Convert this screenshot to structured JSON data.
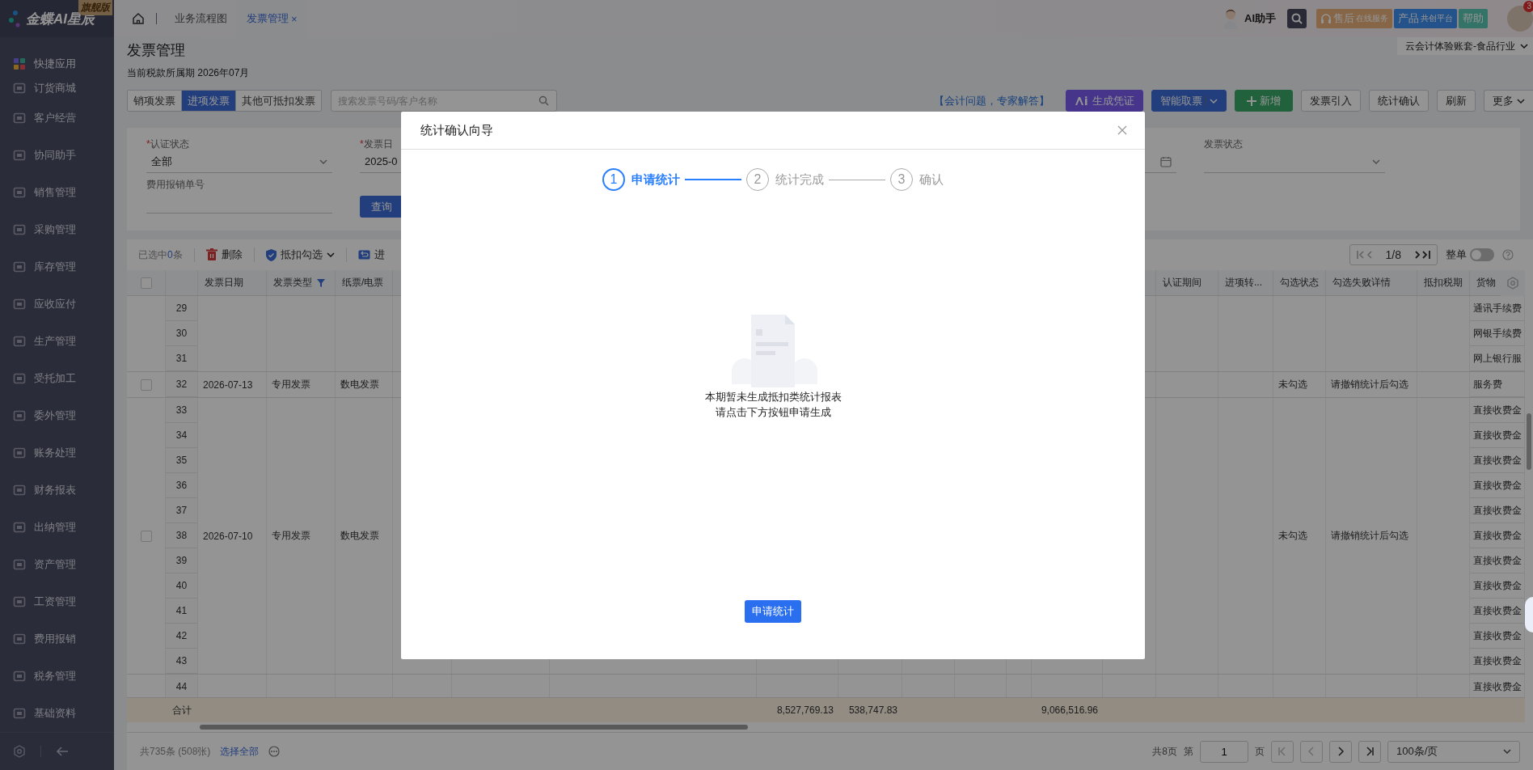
{
  "sidebar": {
    "logo": {
      "text": "金蝶AI星辰",
      "badge": "旗舰版"
    },
    "pinned": {
      "label": "快捷应用"
    },
    "items": [
      {
        "label": "订货商城"
      },
      {
        "label": "客户经营"
      },
      {
        "label": "协同助手"
      },
      {
        "label": "销售管理"
      },
      {
        "label": "采购管理"
      },
      {
        "label": "库存管理"
      },
      {
        "label": "应收应付"
      },
      {
        "label": "生产管理"
      },
      {
        "label": "受托加工"
      },
      {
        "label": "委外管理"
      },
      {
        "label": "账务处理"
      },
      {
        "label": "财务报表"
      },
      {
        "label": "出纳管理"
      },
      {
        "label": "资产管理"
      },
      {
        "label": "工资管理"
      },
      {
        "label": "费用报销"
      },
      {
        "label": "税务管理"
      },
      {
        "label": "基础资料"
      }
    ]
  },
  "topbar": {
    "tabs": [
      {
        "label": "业务流程图",
        "selected": false
      },
      {
        "label": "发票管理",
        "selected": true,
        "close": "×"
      }
    ],
    "assistant": "AI助手",
    "service": {
      "main": "售后",
      "sub": "在线服务"
    },
    "platform": {
      "main": "产品",
      "sub": "共创平台"
    },
    "help": "帮助",
    "notifications": "3"
  },
  "page": {
    "title": "发票管理",
    "period": "当前税款所属期 2026年07月",
    "company": "云会计体验账套-食品行业",
    "invoice_tabs": [
      {
        "label": "销项发票",
        "selected": false
      },
      {
        "label": "进项发票",
        "selected": true
      },
      {
        "label": "其他可抵扣发票",
        "selected": false
      }
    ],
    "search": {
      "placeholder": "搜索发票号码/客户名称"
    },
    "expert_link": "【会计问题，专家解答】",
    "actions": [
      {
        "label": "生成凭证",
        "kind": "ai"
      },
      {
        "label": "智能取票",
        "kind": "split"
      },
      {
        "label": "新增",
        "kind": "add"
      },
      {
        "label": "发票引入",
        "kind": "plain"
      },
      {
        "label": "统计确认",
        "kind": "plain"
      },
      {
        "label": "刷新",
        "kind": "plain"
      },
      {
        "label": "更多",
        "kind": "menu"
      }
    ]
  },
  "filters": {
    "fields": [
      {
        "label": "认证状态",
        "required_mark": "*",
        "value": "全部",
        "kind": "select"
      },
      {
        "label": "发票日",
        "required_mark": "*",
        "value": "2025-0",
        "kind": "date"
      },
      {
        "label": "发票状态",
        "kind": "select"
      },
      {
        "label": "费用报销单号",
        "kind": "text"
      }
    ],
    "query_button": "查询"
  },
  "toolbar": {
    "selected_prefix": "已选中",
    "selected_count": "0",
    "selected_suffix": "条",
    "actions": [
      {
        "label": "删除",
        "kind": "delete"
      },
      {
        "label": "抵扣勾选",
        "kind": "deduct"
      },
      {
        "label": "进",
        "kind": "transfer"
      }
    ],
    "pager": "1/8",
    "whole_toggle": {
      "label": "整单",
      "on": false
    }
  },
  "table": {
    "header_checked": false,
    "left_columns": [
      {
        "label": "发票日期"
      },
      {
        "label": "发票类型",
        "filter": true
      },
      {
        "label": "纸票/电票"
      }
    ],
    "right_columns": [
      {
        "label": "认证期间"
      },
      {
        "label": "进项转..."
      },
      {
        "label": "勾选状态"
      },
      {
        "label": "勾选失败详情"
      },
      {
        "label": "抵扣税期"
      },
      {
        "label": "货物"
      }
    ],
    "groups": [
      {
        "rows": [
          {
            "index": "29",
            "goods": "通讯手续费"
          },
          {
            "index": "30",
            "goods": "网银手续费"
          },
          {
            "index": "31",
            "goods": "网上银行服"
          }
        ]
      },
      {
        "checked": false,
        "date": "2026-07-13",
        "type": "专用发票",
        "medium": "数电发票",
        "check_status": "未勾选",
        "fail_detail": "请撤销统计后勾选",
        "rows": [
          {
            "index": "32",
            "goods": "服务费"
          }
        ]
      },
      {
        "checked": false,
        "date": "2026-07-10",
        "type": "专用发票",
        "medium": "数电发票",
        "check_status": "未勾选",
        "fail_detail": "请撤销统计后勾选",
        "rows": [
          {
            "index": "33",
            "goods": "直接收费金"
          },
          {
            "index": "34",
            "goods": "直接收费金"
          },
          {
            "index": "35",
            "goods": "直接收费金"
          },
          {
            "index": "36",
            "goods": "直接收费金"
          },
          {
            "index": "37",
            "goods": "直接收费金"
          },
          {
            "index": "38",
            "goods": "直接收费金"
          },
          {
            "index": "39",
            "goods": "直接收费金"
          },
          {
            "index": "40",
            "goods": "直接收费金"
          },
          {
            "index": "41",
            "goods": "直接收费金"
          },
          {
            "index": "42",
            "goods": "直接收费金"
          },
          {
            "index": "43",
            "goods": "直接收费金"
          }
        ]
      },
      {
        "rows": [
          {
            "index": "44",
            "goods": "直接收费金"
          }
        ]
      }
    ],
    "totals": {
      "label": "合计",
      "values": [
        "8,527,769.13",
        "538,747.83",
        "9,066,516.96"
      ]
    }
  },
  "footer": {
    "total": "共735条 (508张)",
    "select_all": "选择全部",
    "pages": "共8页",
    "page_prefix": "第",
    "page_value": "1",
    "page_suffix": "页",
    "page_size": "100条/页"
  },
  "modal": {
    "title": "统计确认向导",
    "steps": [
      {
        "number": "1",
        "label": "申请统计",
        "current": true
      },
      {
        "number": "2",
        "label": "统计完成",
        "current": false
      },
      {
        "number": "3",
        "label": "确认",
        "current": false
      }
    ],
    "empty_lines": [
      "本期暂未生成抵扣类统计报表",
      "请点击下方按钮申请生成"
    ],
    "button": "申请统计"
  }
}
